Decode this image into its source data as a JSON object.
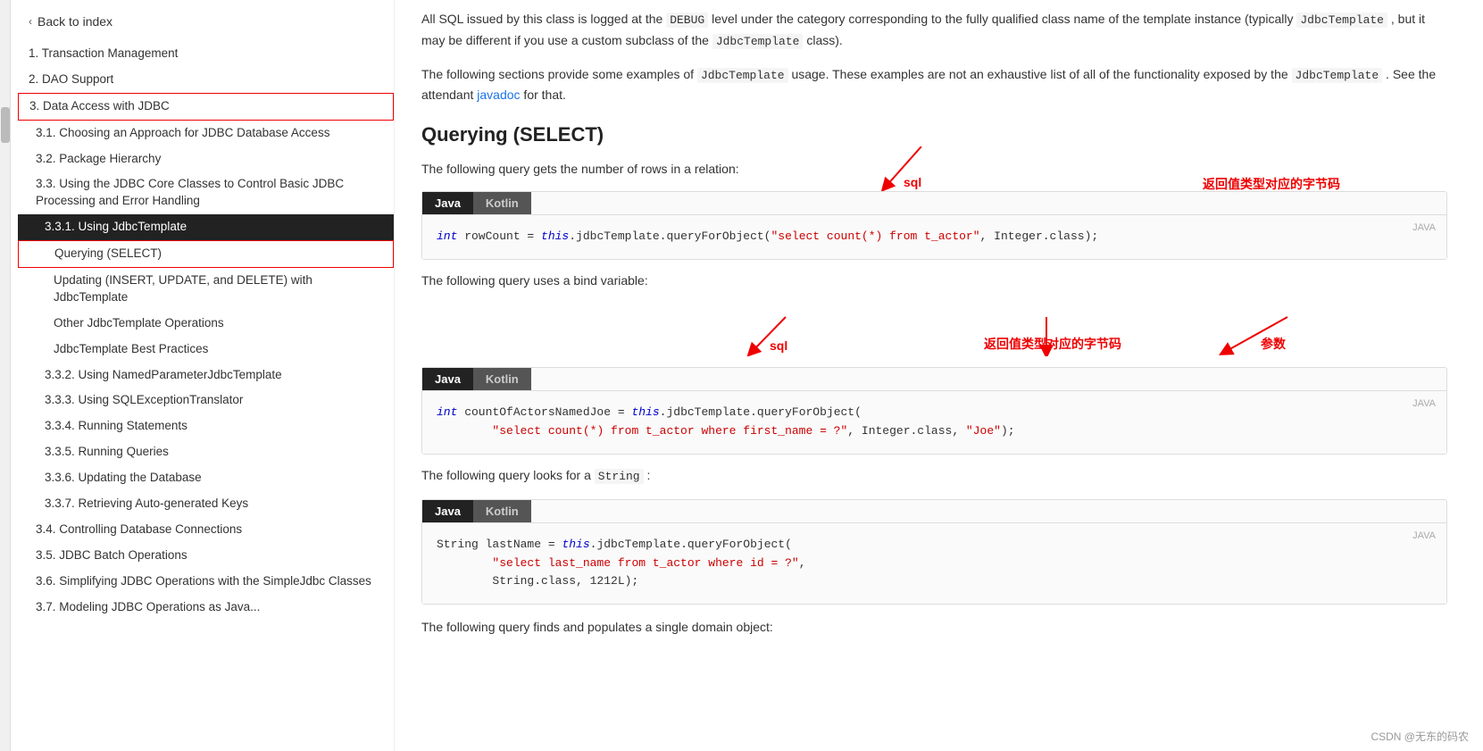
{
  "sidebar": {
    "back_label": "Back to index",
    "items": [
      {
        "id": "s1",
        "label": "1. Transaction Management",
        "level": "level-1",
        "active": false,
        "boxed": false
      },
      {
        "id": "s2",
        "label": "2. DAO Support",
        "level": "level-1",
        "active": false,
        "boxed": false
      },
      {
        "id": "s3",
        "label": "3. Data Access with JDBC",
        "level": "level-1",
        "active": false,
        "boxed": true
      },
      {
        "id": "s3-1",
        "label": "3.1. Choosing an Approach for JDBC Database Access",
        "level": "level-2",
        "active": false,
        "boxed": false
      },
      {
        "id": "s3-2",
        "label": "3.2. Package Hierarchy",
        "level": "level-2",
        "active": false,
        "boxed": false
      },
      {
        "id": "s3-3",
        "label": "3.3. Using the JDBC Core Classes to Control Basic JDBC Processing and Error Handling",
        "level": "level-2",
        "active": false,
        "boxed": false
      },
      {
        "id": "s3-3-1",
        "label": "3.3.1. Using JdbcTemplate",
        "level": "level-3",
        "active": true,
        "boxed": false
      },
      {
        "id": "s3-3-1a",
        "label": "Querying (SELECT)",
        "level": "level-4",
        "active": false,
        "boxed": true
      },
      {
        "id": "s3-3-1b",
        "label": "Updating (INSERT, UPDATE, and DELETE) with JdbcTemplate",
        "level": "level-4",
        "active": false,
        "boxed": false
      },
      {
        "id": "s3-3-1c",
        "label": "Other JdbcTemplate Operations",
        "level": "level-4",
        "active": false,
        "boxed": false
      },
      {
        "id": "s3-3-1d",
        "label": "JdbcTemplate Best Practices",
        "level": "level-4",
        "active": false,
        "boxed": false
      },
      {
        "id": "s3-3-2",
        "label": "3.3.2. Using NamedParameterJdbcTemplate",
        "level": "level-3",
        "active": false,
        "boxed": false
      },
      {
        "id": "s3-3-3",
        "label": "3.3.3. Using SQLExceptionTranslator",
        "level": "level-3",
        "active": false,
        "boxed": false
      },
      {
        "id": "s3-3-4",
        "label": "3.3.4. Running Statements",
        "level": "level-3",
        "active": false,
        "boxed": false
      },
      {
        "id": "s3-3-5",
        "label": "3.3.5. Running Queries",
        "level": "level-3",
        "active": false,
        "boxed": false
      },
      {
        "id": "s3-3-6",
        "label": "3.3.6. Updating the Database",
        "level": "level-3",
        "active": false,
        "boxed": false
      },
      {
        "id": "s3-3-7",
        "label": "3.3.7. Retrieving Auto-generated Keys",
        "level": "level-3",
        "active": false,
        "boxed": false
      },
      {
        "id": "s3-4",
        "label": "3.4. Controlling Database Connections",
        "level": "level-2",
        "active": false,
        "boxed": false
      },
      {
        "id": "s3-5",
        "label": "3.5. JDBC Batch Operations",
        "level": "level-2",
        "active": false,
        "boxed": false
      },
      {
        "id": "s3-6",
        "label": "3.6. Simplifying JDBC Operations with the SimpleJdbc Classes",
        "level": "level-2",
        "active": false,
        "boxed": false
      },
      {
        "id": "s3-7",
        "label": "3.7. Modeling JDBC Operations as Java...",
        "level": "level-2",
        "active": false,
        "boxed": false
      }
    ]
  },
  "main": {
    "intro1": "All SQL issued by this class is logged at the ",
    "intro1_code": "DEBUG",
    "intro1_cont": " level under the category corresponding to the fully qualified class name of the template instance (typically ",
    "intro1_code2": "JdbcTemplate",
    "intro1_cont2": ", but it may be different if you use a custom subclass of the ",
    "intro1_code3": "JdbcTemplate",
    "intro1_cont3": " class).",
    "intro2": "The following sections provide some examples of ",
    "intro2_code": "JdbcTemplate",
    "intro2_cont": " usage. These examples are not an exhaustive list of all of the functionality exposed by the ",
    "intro2_code2": "JdbcTemplate",
    "intro2_cont2": ". See the attendant ",
    "intro2_link": "javadoc",
    "intro2_cont3": " for that.",
    "section_title": "Querying (SELECT)",
    "query1_text": "The following query gets the number of rows in a relation:",
    "code1_label": "JAVA",
    "code1_line": "int rowCount = this.jdbcTemplate.queryForObject(\"select count(*) from t_actor\", Integer.class);",
    "query2_text": "The following query uses a bind variable:",
    "code2_label": "JAVA",
    "code2_line1": "int countOfActorsNamedJoe = this.jdbcTemplate.queryForObject(",
    "code2_line2": "        \"select count(*) from t_actor where first_name = ?\", Integer.class, \"Joe\");",
    "query3_text_pre": "The following query looks for a ",
    "query3_code": "String",
    "query3_text_post": ":",
    "code3_label": "JAVA",
    "code3_line1": "String lastName = this.jdbcTemplate.queryForObject(",
    "code3_line2": "        \"select last_name from t_actor where id = ?\",",
    "code3_line3": "        String.class, 1212L);",
    "query4_text": "The following query finds and populates a single domain object:",
    "annotations": {
      "sql1_label": "sql",
      "return_type1": "返回值类型对应的字节码",
      "sql2_label": "sql",
      "return_type2": "返回值类型对应的字节码",
      "param_label": "参数"
    },
    "tabs": [
      {
        "label": "Java",
        "active": true
      },
      {
        "label": "Kotlin",
        "active": false
      }
    ],
    "watermark": "CSDN @无东的码农"
  }
}
